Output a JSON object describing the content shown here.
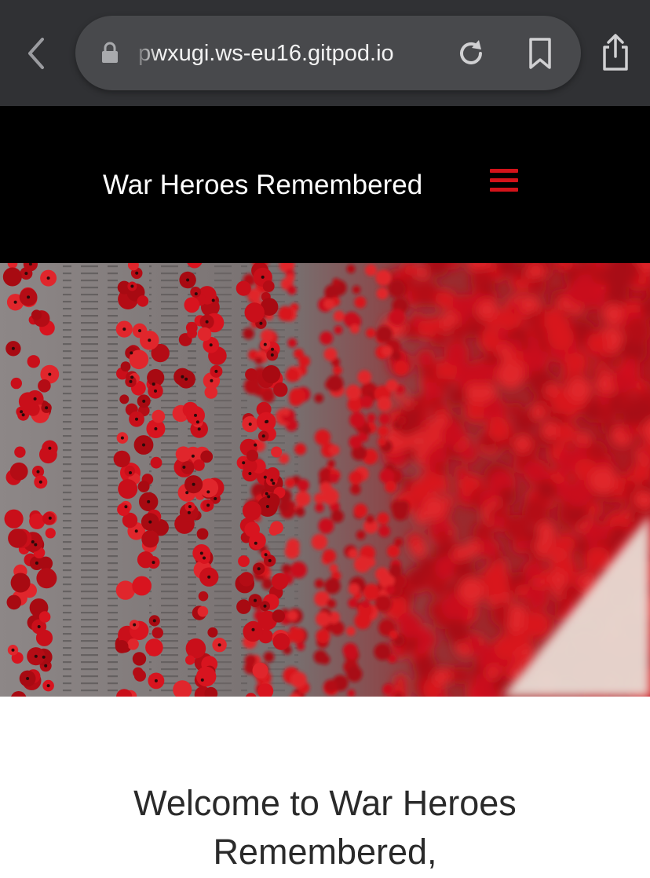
{
  "browser": {
    "url": "pwxugi.ws-eu16.gitpod.io",
    "icons": [
      "back-arrow-icon",
      "lock-icon",
      "reload-icon",
      "bookmark-icon",
      "share-icon"
    ]
  },
  "header": {
    "site_title": "War Heroes Remembered",
    "menu_icon": "hamburger-menu-icon",
    "accent_color": "#d3131a"
  },
  "hero": {
    "image_subject": "poppies-on-memorial-wall-photo"
  },
  "main": {
    "welcome_line1": "Welcome to War Heroes",
    "welcome_line2": "Remembered,"
  }
}
